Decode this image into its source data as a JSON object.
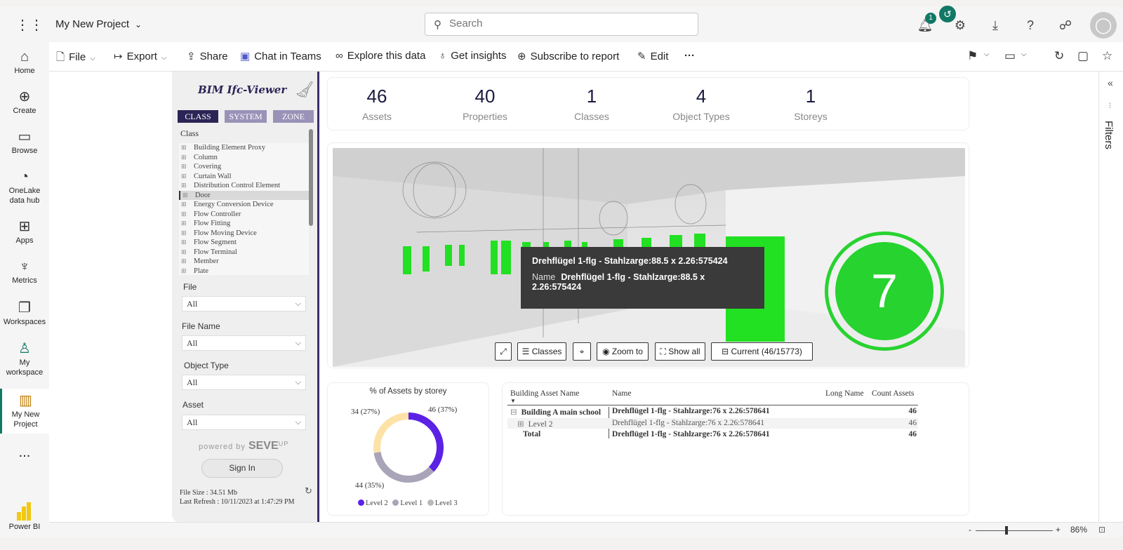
{
  "header": {
    "project_name": "My New Project",
    "search_placeholder": "Search",
    "notification_count": "1"
  },
  "leftnav": [
    {
      "label": "Home",
      "icon": "home-icon"
    },
    {
      "label": "Create",
      "icon": "plus-circle-icon"
    },
    {
      "label": "Browse",
      "icon": "folder-icon"
    },
    {
      "label": "OneLake data hub",
      "icon": "onelake-icon"
    },
    {
      "label": "Apps",
      "icon": "apps-icon"
    },
    {
      "label": "Metrics",
      "icon": "trophy-icon"
    },
    {
      "label": "Workspaces",
      "icon": "workspaces-icon"
    },
    {
      "label": "My workspace",
      "icon": "person-icon"
    },
    {
      "label": "My New Project",
      "icon": "report-icon"
    },
    {
      "label": "...",
      "icon": "more-icon"
    }
  ],
  "powerbi_label": "Power BI",
  "toolbar": {
    "file": "File",
    "export": "Export",
    "share": "Share",
    "chat": "Chat in Teams",
    "explore": "Explore this data",
    "insights": "Get insights",
    "subscribe": "Subscribe to report",
    "edit": "Edit",
    "more": "···"
  },
  "filters_label": "Filters",
  "sidebar": {
    "title": "BIM Ifc-Viewer",
    "tabs": [
      "CLASS",
      "SYSTEM",
      "ZONE"
    ],
    "class_label": "Class",
    "classes": [
      "Building Element Proxy",
      "Column",
      "Covering",
      "Curtain Wall",
      "Distribution Control Element",
      "Door",
      "Energy Conversion Device",
      "Flow Controller",
      "Flow Fitting",
      "Flow Moving Device",
      "Flow Segment",
      "Flow Terminal",
      "Member",
      "Plate"
    ],
    "selected_class": "Door",
    "filters": [
      {
        "label": "File",
        "value": "All"
      },
      {
        "label": "File Name",
        "value": "All"
      },
      {
        "label": "Object Type",
        "value": "All"
      },
      {
        "label": "Asset",
        "value": "All"
      }
    ],
    "powered_by": "powered by",
    "brand": "SEVE",
    "brand_sup": "UP",
    "signin": "Sign In",
    "file_size": "File Size : 34.51 Mb",
    "last_refresh": "Last Refresh : 10/11/2023 at 1:47:29 PM"
  },
  "kpis": [
    {
      "value": "46",
      "label": "Assets"
    },
    {
      "value": "40",
      "label": "Properties"
    },
    {
      "value": "1",
      "label": "Classes"
    },
    {
      "value": "4",
      "label": "Object Types"
    },
    {
      "value": "1",
      "label": "Storeys"
    }
  ],
  "viewer": {
    "tooltip_title": "Drehflügel 1-flg - Stahlzarge:88.5 x 2.26:575424",
    "tooltip_key": "Name",
    "tooltip_value": "Drehflügel 1-flg - Stahlzarge:88.5 x 2.26:575424",
    "selection_count": "7",
    "buttons": [
      "Classes",
      "Zoom to",
      "Show all",
      "Current (46/15773)"
    ]
  },
  "chart_data": {
    "type": "pie",
    "title": "% of Assets by storey",
    "categories": [
      "Level 2",
      "Level 1",
      "Level 3"
    ],
    "values": [
      46,
      44,
      34
    ],
    "percent_labels": [
      "46 (37%)",
      "44 (35%)",
      "34 (27%)"
    ],
    "colors": [
      "#5b22e6",
      "#a9a4b8",
      "#fde2a8"
    ],
    "legend_position": "bottom"
  },
  "table": {
    "headers": [
      "Building Asset Name",
      "Name",
      "Long Name",
      "Count Assets"
    ],
    "rows": [
      {
        "asset": "Building A main school",
        "name": "Drehflügel 1-flg - Stahlzarge:76 x 2.26:578641",
        "long": "",
        "count": "46"
      },
      {
        "asset": "Level 2",
        "name": "Drehflügel 1-flg - Stahlzarge:76 x 2.26:578641",
        "long": "",
        "count": "46"
      },
      {
        "asset": "Total",
        "name": "Drehflügel 1-flg - Stahlzarge:76 x 2.26:578641",
        "long": "",
        "count": "46"
      }
    ]
  },
  "status": {
    "zoom": "86%"
  }
}
